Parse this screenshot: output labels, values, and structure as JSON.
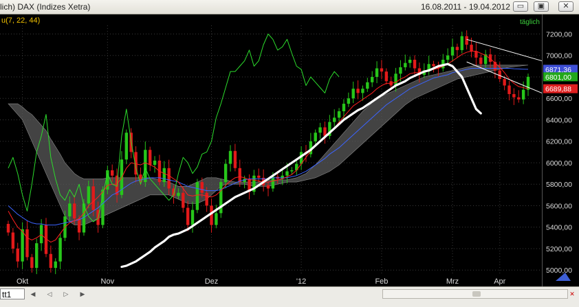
{
  "window": {
    "title": "lich)  DAX (Indizes Xetra)",
    "date_range": "16.08.2011 - 19.04.2012",
    "indicator_label": "u(7, 22, 44)",
    "interval_label": "täglich",
    "sheet_tab": "tt1",
    "buttons": {
      "minimize": "▭",
      "maximize": "▣",
      "close": "✕"
    }
  },
  "colors": {
    "background": "#000000",
    "grid": "#3a3a3a",
    "candle_up": "#27c61a",
    "candle_down": "#e21a1a",
    "tenkan": "#ff2020",
    "kijun": "#3c64ff",
    "chikou": "#2cdc2c",
    "cloud": "#5a5a5a",
    "trend_overlay": "#ffffff",
    "badge_blue": "#3e4fd6",
    "badge_green": "#22a81a",
    "badge_red": "#e02020"
  },
  "chart_data": {
    "type": "candlestick",
    "x_labels": [
      "Okt",
      "Nov",
      "Dez",
      "'12",
      "Feb",
      "Mrz",
      "Apr"
    ],
    "y_ticks": [
      "7200,00",
      "7000,00",
      "6800,00",
      "6600,00",
      "6400,00",
      "6200,00",
      "6000,00",
      "5800,00",
      "5600,00",
      "5400,00",
      "5200,00",
      "5000,00"
    ],
    "ylim": [
      4950,
      7280
    ],
    "price_badges": [
      {
        "label": "6871,36",
        "value": 6871.36,
        "series": "kijun"
      },
      {
        "label": "6801,00",
        "value": 6801.0,
        "series": "close"
      },
      {
        "label": "6689,88",
        "value": 6689.88,
        "series": "tenkan"
      }
    ],
    "close": [
      5350,
      5200,
      5080,
      5380,
      5120,
      5020,
      5250,
      5420,
      5150,
      5020,
      5080,
      5300,
      5500,
      5620,
      5480,
      5350,
      5620,
      5780,
      5560,
      5420,
      5750,
      5930,
      5880,
      5700,
      6030,
      6280,
      6100,
      5890,
      5820,
      6120,
      5980,
      6020,
      5820,
      5950,
      5760,
      5690,
      5720,
      5580,
      5420,
      5560,
      5820,
      5720,
      5600,
      5420,
      5530,
      5820,
      5990,
      6110,
      5950,
      5820,
      5850,
      5730,
      5880,
      5860,
      5790,
      5760,
      5870,
      5850,
      5880,
      5920,
      5930,
      5990,
      6100,
      6080,
      6200,
      6280,
      6330,
      6250,
      6380,
      6420,
      6480,
      6550,
      6600,
      6690,
      6650,
      6690,
      6750,
      6800,
      6880,
      6850,
      6760,
      6720,
      6830,
      6890,
      6930,
      6960,
      6880,
      6820,
      6860,
      6920,
      6900,
      6880,
      6960,
      7000,
      7080,
      7050,
      7180,
      7100,
      7040,
      6980,
      6920,
      7010,
      6940,
      6860,
      6780,
      6720,
      6640,
      6610,
      6590,
      6680,
      6801
    ],
    "tenkan_sen": [
      5550,
      5470,
      5400,
      5360,
      5300,
      5280,
      5300,
      5330,
      5290,
      5260,
      5280,
      5340,
      5400,
      5440,
      5460,
      5480,
      5530,
      5600,
      5640,
      5680,
      5730,
      5790,
      5800,
      5800,
      5860,
      5950,
      6000,
      5990,
      5980,
      6000,
      5980,
      5960,
      5920,
      5900,
      5880,
      5850,
      5820,
      5760,
      5700,
      5690,
      5700,
      5700,
      5690,
      5680,
      5700,
      5740,
      5790,
      5830,
      5860,
      5870,
      5860,
      5840,
      5840,
      5830,
      5820,
      5820,
      5830,
      5840,
      5850,
      5870,
      5890,
      5930,
      5990,
      6050,
      6110,
      6160,
      6200,
      6240,
      6280,
      6320,
      6380,
      6430,
      6480,
      6530,
      6560,
      6590,
      6620,
      6650,
      6690,
      6720,
      6740,
      6740,
      6750,
      6780,
      6800,
      6830,
      6840,
      6840,
      6850,
      6860,
      6870,
      6880,
      6900,
      6920,
      6950,
      6980,
      7010,
      7030,
      7040,
      7040,
      7020,
      7000,
      6970,
      6930,
      6890,
      6840,
      6780,
      6740,
      6710,
      6700,
      6689.88
    ],
    "kijun_sen": [
      5600,
      5560,
      5520,
      5490,
      5460,
      5440,
      5430,
      5430,
      5420,
      5420,
      5420,
      5430,
      5440,
      5450,
      5460,
      5470,
      5490,
      5520,
      5550,
      5580,
      5620,
      5660,
      5700,
      5720,
      5750,
      5780,
      5810,
      5830,
      5840,
      5850,
      5860,
      5860,
      5860,
      5850,
      5840,
      5830,
      5820,
      5800,
      5780,
      5770,
      5760,
      5750,
      5740,
      5740,
      5740,
      5750,
      5770,
      5790,
      5810,
      5830,
      5840,
      5850,
      5850,
      5850,
      5850,
      5850,
      5860,
      5860,
      5860,
      5860,
      5870,
      5880,
      5900,
      5920,
      5950,
      5980,
      6010,
      6040,
      6080,
      6110,
      6140,
      6180,
      6220,
      6260,
      6300,
      6340,
      6380,
      6420,
      6460,
      6500,
      6540,
      6570,
      6600,
      6630,
      6660,
      6690,
      6710,
      6730,
      6750,
      6770,
      6790,
      6800,
      6810,
      6820,
      6840,
      6850,
      6860,
      6870,
      6880,
      6880,
      6880,
      6880,
      6880,
      6880,
      6880,
      6880,
      6880,
      6876,
      6874,
      6872,
      6871.36
    ],
    "chikou_span": [
      5950,
      6050,
      5900,
      5700,
      5550,
      5800,
      6100,
      6250,
      6450,
      6050,
      5850,
      5700,
      5650,
      5750,
      5680,
      5800,
      5600,
      5500,
      5450,
      5480,
      5700,
      5900,
      5800,
      5780,
      6250,
      6500,
      6200,
      5950,
      5800,
      5950,
      5850,
      5800,
      5750,
      5700,
      5650,
      5700,
      5900,
      6050,
      6000,
      5900,
      5960,
      6080,
      6100,
      6200,
      6420,
      6550,
      6700,
      6850,
      6850,
      6900,
      6950,
      7050,
      6900,
      6950,
      7100,
      7200,
      7150,
      7050,
      7080,
      7150,
      7020,
      6900,
      6870,
      6720,
      6800,
      6750,
      6700,
      6650,
      6780,
      6850,
      6801
    ],
    "cloud_upper": [
      6550,
      6550,
      6550,
      6520,
      6480,
      6450,
      6400,
      6350,
      6300,
      6220,
      6150,
      6080,
      6000,
      5950,
      5900,
      5870,
      5850,
      5850,
      5850,
      5850,
      5850,
      5860,
      5860,
      5860,
      5860,
      5860,
      5860,
      5860,
      5860,
      5860,
      5860,
      5850,
      5840,
      5830,
      5820,
      5800,
      5780,
      5780,
      5780,
      5800,
      5820,
      5840,
      5860,
      5860,
      5860,
      5850,
      5840,
      5830,
      5820,
      5820,
      5820,
      5820,
      5820,
      5820,
      5830,
      5840,
      5840,
      5840,
      5840,
      5840,
      5850,
      5860,
      5880,
      5900,
      5940,
      5980,
      6030,
      6080,
      6130,
      6180,
      6230,
      6280,
      6330,
      6380,
      6430,
      6480,
      6520,
      6560,
      6600,
      6620,
      6640,
      6660,
      6680,
      6700,
      6720,
      6740,
      6760,
      6780,
      6800,
      6810,
      6820,
      6830,
      6840,
      6850,
      6860,
      6870,
      6880,
      6890,
      6900,
      6910,
      6910,
      6910,
      6910,
      6910,
      6910,
      6910,
      6910,
      6910,
      6910,
      6910,
      6910
    ],
    "cloud_lower": [
      6550,
      6500,
      6450,
      6400,
      6300,
      6200,
      6100,
      6000,
      5900,
      5800,
      5700,
      5600,
      5500,
      5450,
      5420,
      5420,
      5420,
      5440,
      5460,
      5480,
      5500,
      5520,
      5540,
      5560,
      5580,
      5600,
      5620,
      5640,
      5660,
      5680,
      5700,
      5700,
      5700,
      5700,
      5700,
      5680,
      5660,
      5640,
      5620,
      5620,
      5620,
      5640,
      5660,
      5700,
      5740,
      5780,
      5800,
      5800,
      5800,
      5800,
      5800,
      5790,
      5780,
      5780,
      5780,
      5780,
      5790,
      5800,
      5810,
      5820,
      5820,
      5820,
      5830,
      5840,
      5850,
      5860,
      5880,
      5900,
      5920,
      5950,
      5980,
      6020,
      6060,
      6100,
      6140,
      6180,
      6220,
      6260,
      6300,
      6340,
      6380,
      6420,
      6460,
      6500,
      6540,
      6570,
      6600,
      6620,
      6640,
      6660,
      6680,
      6700,
      6720,
      6740,
      6760,
      6780,
      6790,
      6800,
      6810,
      6820,
      6830,
      6840,
      6850,
      6860,
      6870,
      6880,
      6890,
      6895,
      6900,
      6905,
      6910
    ],
    "trend_overlay": [
      5030,
      5040,
      5060,
      5080,
      5110,
      5140,
      5170,
      5210,
      5240,
      5270,
      5310,
      5330,
      5340,
      5360,
      5380,
      5410,
      5440,
      5470,
      5500,
      5530,
      5560,
      5590,
      5620,
      5650,
      5680,
      5700,
      5720,
      5740,
      5760,
      5790,
      5820,
      5850,
      5880,
      5910,
      5940,
      5970,
      6000,
      6030,
      6060,
      6090,
      6120,
      6160,
      6200,
      6240,
      6280,
      6320,
      6360,
      6400,
      6430,
      6460,
      6490,
      6510,
      6540,
      6570,
      6600,
      6630,
      6660,
      6690,
      6720,
      6740,
      6760,
      6790,
      6810,
      6830,
      6850,
      6860,
      6880,
      6900,
      6910,
      6920,
      6900,
      6850,
      6800,
      6700,
      6600,
      6500,
      6460
    ]
  }
}
